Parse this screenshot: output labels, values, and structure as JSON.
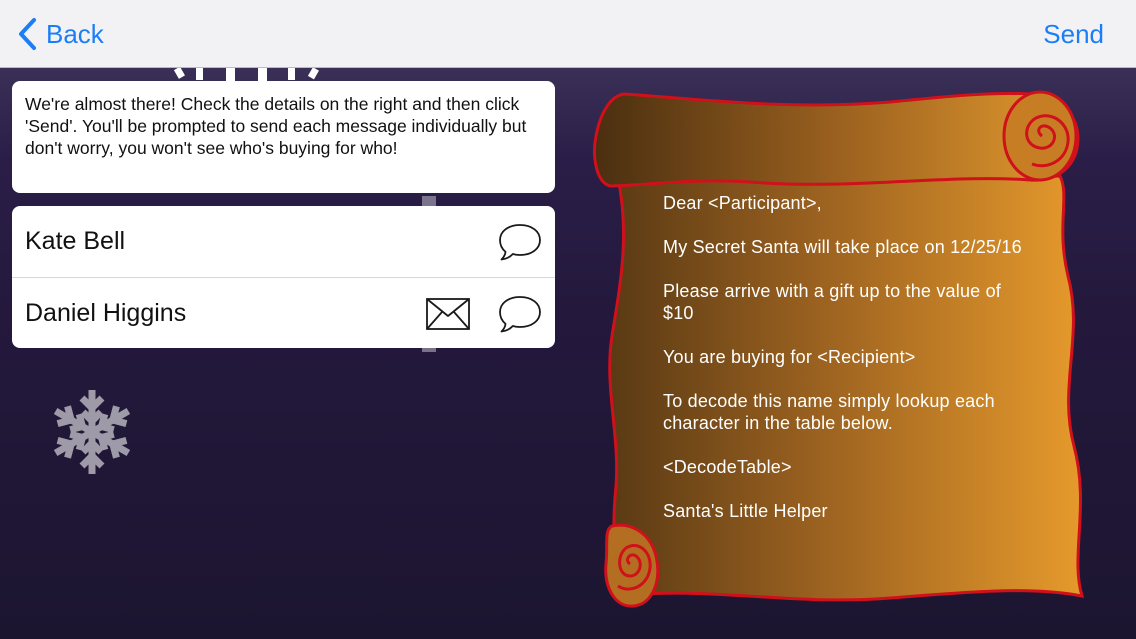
{
  "navbar": {
    "back_label": "Back",
    "send_label": "Send"
  },
  "info": {
    "text": "We're almost there! Check the details on the right and then click 'Send'. You'll be prompted to send each message individually but don't worry, you won't see who's buying for who!"
  },
  "contacts": [
    {
      "name": "Kate Bell",
      "icons": [
        "message-bubble-icon"
      ]
    },
    {
      "name": "Daniel Higgins",
      "icons": [
        "envelope-icon",
        "message-bubble-icon"
      ]
    }
  ],
  "letter": {
    "greeting": "Dear <Participant>,",
    "date_line": "My Secret Santa will take place on 12/25/16",
    "gift_line": "Please arrive with a gift up to the value of $10",
    "buying_line": "You are buying for <Recipient>",
    "decode_line": "To decode this name simply lookup each character in the table below.",
    "table_placeholder": "<DecodeTable>",
    "signature": "Santa's Little Helper"
  },
  "colors": {
    "accent": "#1b7ef6",
    "scroll_outline": "#d0101a",
    "scroll_dark": "#5a3a14",
    "scroll_light": "#e69a2c"
  }
}
